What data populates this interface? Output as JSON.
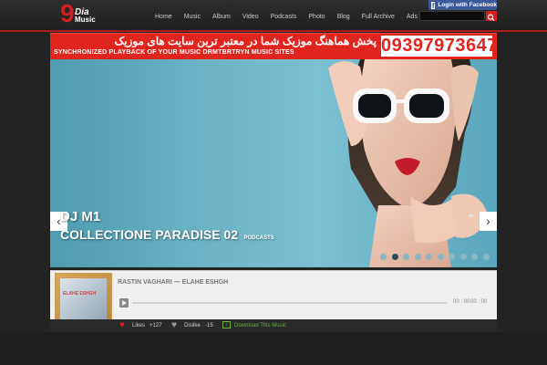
{
  "logo": {
    "number": "9",
    "line1": "Dia",
    "line2": "Music"
  },
  "facebook": {
    "label": "Login with Facebook"
  },
  "nav": {
    "items": [
      "Home",
      "Music",
      "Album",
      "Video",
      "Podcasts",
      "Photo",
      "Blog",
      "Full Archive",
      "Ads"
    ]
  },
  "search": {
    "placeholder": ""
  },
  "banner": {
    "persian_text": "پخش هماهنگ موزیک شما در معتبر ترین سایت های موزیک",
    "english_text": "SYNCHRONIZED PLAYBACK OF YOUR MUSIC DRMTBRTRYN MUSIC SITES",
    "phone": "09397973647"
  },
  "slider": {
    "title_line1": "DJ M1",
    "title_line2": "COLLECTIONE PARADISE 02",
    "badge": "PODCASTS",
    "prev_arrow": "‹",
    "next_arrow": "›",
    "dots": [
      false,
      true,
      false,
      false,
      false,
      false,
      false,
      false,
      false,
      false
    ],
    "accent_color": "#c41b2a"
  },
  "player": {
    "track_title": "RASTIN VAGHARI — ELAHE ESHGH",
    "cover_text": "ELAHE ESHGH",
    "time_current": "00 : 00",
    "time_total": "00 : 00"
  },
  "actions": {
    "likes_label": "Likes",
    "likes_count": "+127",
    "dislike_label": "Dislike",
    "dislike_count": "-15",
    "download_label": "Download This Music"
  }
}
